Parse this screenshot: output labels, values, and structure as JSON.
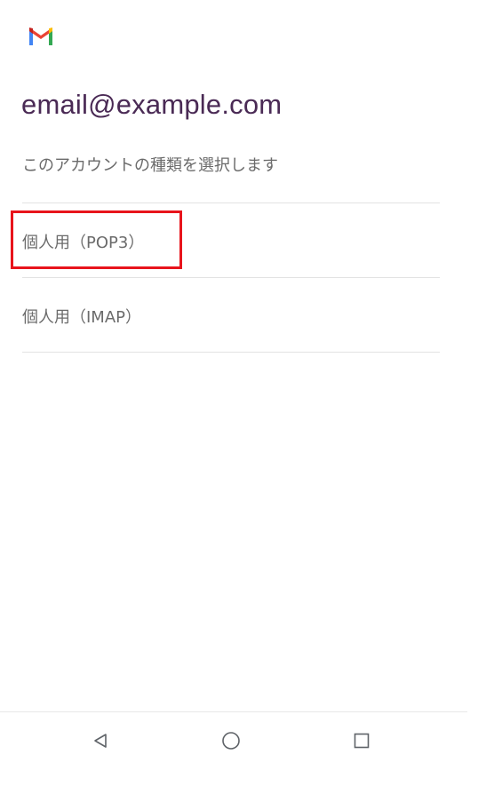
{
  "header": {
    "logo_icon": "gmail-logo-icon",
    "account_email": "email@example.com",
    "subtitle": "このアカウントの種類を選択します"
  },
  "options": [
    {
      "label": "個人用（POP3）"
    },
    {
      "label": "個人用（IMAP）"
    }
  ],
  "highlight_color": "#e8141c",
  "navigation": {
    "back_icon": "triangle-back-icon",
    "home_icon": "circle-home-icon",
    "recents_icon": "square-recents-icon"
  }
}
